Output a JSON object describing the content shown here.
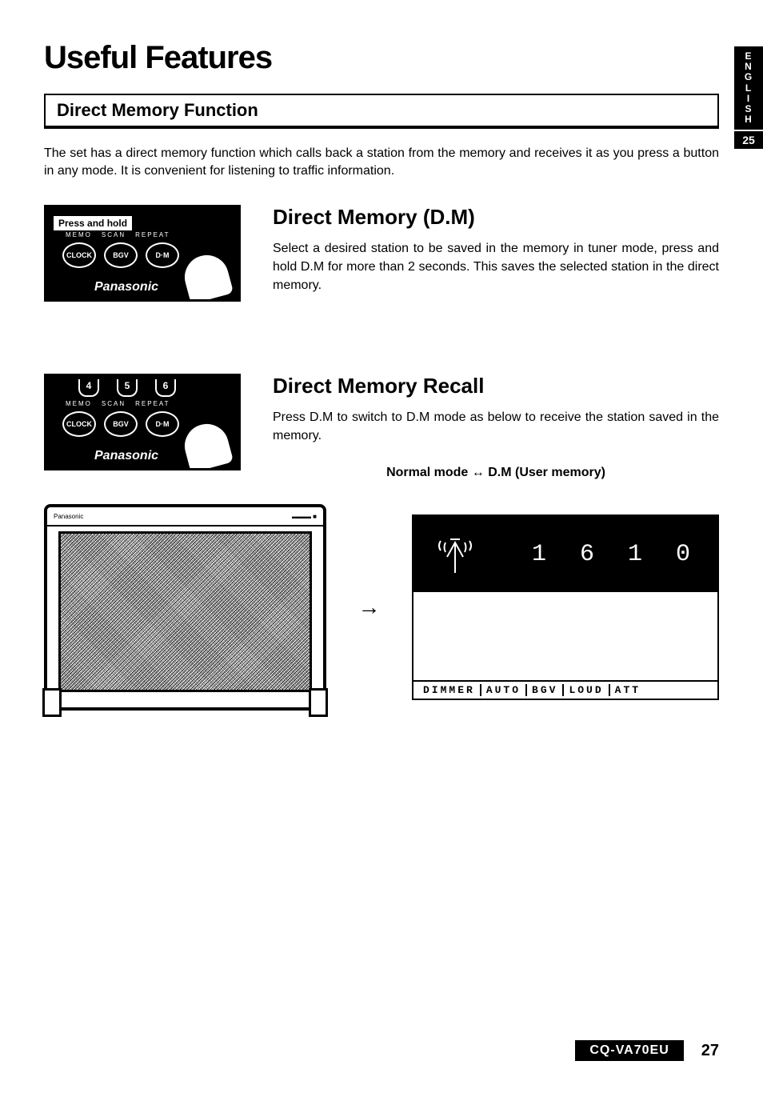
{
  "side": {
    "language": "ENGLISH",
    "section_num": "25"
  },
  "title": "Useful Features",
  "section_heading": "Direct Memory Function",
  "intro": "The set has a direct memory function which calls back a station from the memory and receives it as you press a button in any mode. It is convenient for listening to traffic information.",
  "panel": {
    "press_hold": "Press and hold",
    "nums": [
      "4",
      "5",
      "6"
    ],
    "sublabels": [
      "MEMO",
      "SCAN",
      "REPEAT"
    ],
    "buttons": [
      "CLOCK",
      "BGV",
      "D·M"
    ],
    "brand": "Panasonic"
  },
  "block1": {
    "heading": "Direct Memory (D.M)",
    "body": "Select a desired station to be saved in the memory in tuner mode, press and hold D.M for more than 2 seconds. This saves the selected station in the direct memory."
  },
  "block2": {
    "heading": "Direct Memory Recall",
    "body": "Press D.M to switch to D.M mode as below to receive the station saved in the memory.",
    "mode_line": "Normal mode ↔ D.M (User memory)"
  },
  "monitor": {
    "brand": "Panasonic"
  },
  "arrow": "→",
  "lcd": {
    "frequency": "1 6 1 0",
    "bottom": [
      "DIMMER",
      "AUTO",
      "BGV",
      "LOUD",
      "ATT"
    ]
  },
  "footer": {
    "model": "CQ-VA70EU",
    "page": "27"
  }
}
